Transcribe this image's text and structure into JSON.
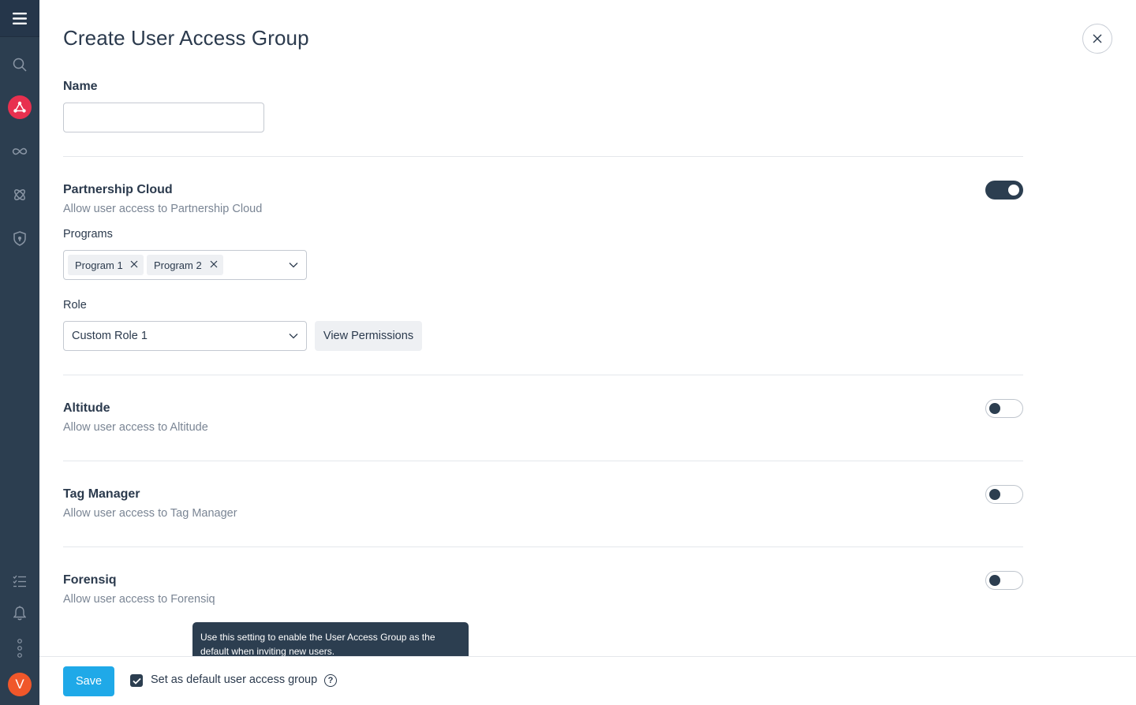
{
  "page": {
    "title": "Create User Access Group"
  },
  "name_field": {
    "label": "Name",
    "value": "",
    "placeholder": ""
  },
  "sections": {
    "partnership_cloud": {
      "title": "Partnership Cloud",
      "description": "Allow user access to Partnership Cloud",
      "enabled": true,
      "programs_label": "Programs",
      "programs": [
        "Program 1",
        "Program 2"
      ],
      "role_label": "Role",
      "role_value": "Custom Role 1",
      "view_permissions_label": "View Permissions"
    },
    "altitude": {
      "title": "Altitude",
      "description": "Allow user access to Altitude",
      "enabled": false
    },
    "tag_manager": {
      "title": "Tag Manager",
      "description": "Allow user access to Tag Manager",
      "enabled": false
    },
    "forensiq": {
      "title": "Forensiq",
      "description": "Allow user access to Forensiq",
      "enabled": false
    }
  },
  "footer": {
    "save_label": "Save",
    "default_checkbox_label": "Set as default user access group",
    "default_checked": true,
    "help_glyph": "?"
  },
  "tooltip": {
    "text": "Use this setting to enable the User Access Group as the default when inviting new users."
  },
  "sidebar": {
    "avatar_initial": "V",
    "icons": [
      "menu-icon",
      "search-icon",
      "network-icon",
      "infinity-icon",
      "atom-icon",
      "shield-icon",
      "checklist-icon",
      "bell-icon",
      "more-vertical-icon"
    ]
  },
  "colors": {
    "sidebar": "#2c3e50",
    "active_accent": "#e8304f",
    "primary_button": "#1fa9e8",
    "avatar": "#f0572a"
  }
}
